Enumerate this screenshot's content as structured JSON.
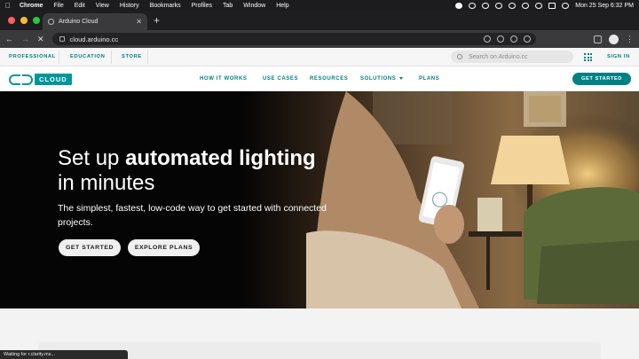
{
  "os": {
    "app_name": "Chrome",
    "menus": [
      "File",
      "Edit",
      "View",
      "History",
      "Bookmarks",
      "Profiles",
      "Tab",
      "Window",
      "Help"
    ],
    "clock": "Mon 25 Sep  6:32 PM"
  },
  "browser": {
    "tab_title": "Arduino Cloud",
    "url": "cloud.arduino.cc",
    "status_text": "Waiting for r.clarity.ms..."
  },
  "site": {
    "top_links": [
      "PROFESSIONAL",
      "EDUCATION",
      "STORE"
    ],
    "search_placeholder": "Search on Arduino.cc",
    "sign_in": "SIGN IN",
    "logo_text": "CLOUD",
    "nav": {
      "how_it_works": "HOW IT WORKS",
      "use_cases": "USE CASES",
      "resources": "RESOURCES",
      "solutions": "SOLUTIONS",
      "plans": "PLANS"
    },
    "nav_cta": "GET STARTED",
    "accent_color": "#008184"
  },
  "hero": {
    "title_part1": "Set up ",
    "title_bold": "automated lighting",
    "title_part2": "in minutes",
    "subtitle": "The simplest, fastest, low-code way to get started with connected projects.",
    "primary_button": "GET STARTED",
    "secondary_button": "EXPLORE PLANS"
  }
}
